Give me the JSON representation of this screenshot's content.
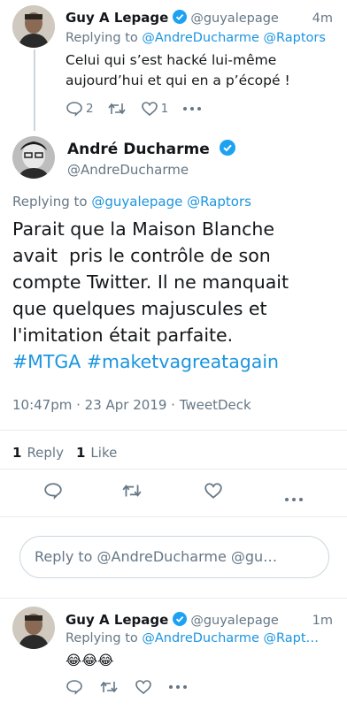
{
  "tweet1": {
    "name": "Guy A Lepage",
    "handle": "@guyalepage",
    "time": "4m",
    "replying_to_prefix": "Replying to",
    "replying_to_users": "@AndreDucharme @Raptors",
    "text_line1": "Celui qui s’est hacké lui-même",
    "text_line2": "aujourd’hui et qui en a p’écopé !",
    "reply_count": "2",
    "like_count": "1"
  },
  "main_tweet": {
    "name": "André Ducharme",
    "handle": "@AndreDucharme",
    "replying_to_prefix": "Replying to",
    "replying_to_users": "@guyalepage @Raptors",
    "text_line1": "Parait que la Maison Blanche",
    "text_line2": "avait  pris le contrôle de son",
    "text_line3": "compte Twitter. Il ne manquait",
    "text_line4": "que quelques majuscules et",
    "text_line5": "l'imitation était parfaite.",
    "hashtag1": "#MTGA",
    "hashtag2": "#maketvagreatagain",
    "meta": "10:47pm · 23 Apr 2019 · TweetDeck",
    "reply_count": "1",
    "reply_label": "Reply",
    "like_count": "1",
    "like_label": "Like"
  },
  "reply_box": {
    "placeholder": "Reply to @AndreDucharme @gu…"
  },
  "tweet3": {
    "name": "Guy A Lepage",
    "handle": "@guyalepage",
    "time": "1m",
    "replying_to_prefix": "Replying to",
    "replying_to_users": "@AndreDucharme @Rapt…",
    "text": "😂😂😂"
  },
  "colors": {
    "link": "#1b95e0",
    "secondary": "#657786",
    "verified": "#1da1f2",
    "divider": "#e6ecf0"
  },
  "icons": [
    "reply-icon",
    "retweet-icon",
    "like-icon",
    "more-icon",
    "verified-badge-icon"
  ]
}
